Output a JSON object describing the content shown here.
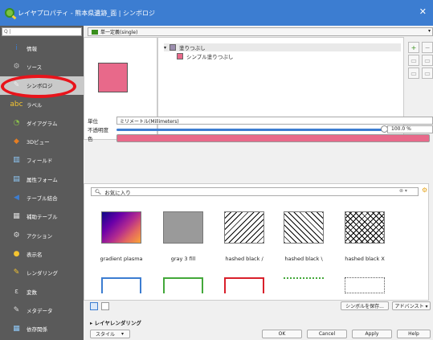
{
  "window": {
    "title": "レイヤプロパティ - 熊本県遺跡_面 | シンボロジ",
    "close_glyph": "✕"
  },
  "sidebar": {
    "search_text": "Q |",
    "items": [
      {
        "label": "情報",
        "icon": "info-icon",
        "glyph": "i",
        "color": "#3c7dd1"
      },
      {
        "label": "ソース",
        "icon": "source-icon",
        "glyph": "⚙",
        "color": "#bbbbbb"
      },
      {
        "label": "シンボロジ",
        "icon": "paintbrush-icon",
        "glyph": "✎",
        "color": "#eeeeee"
      },
      {
        "label": "ラベル",
        "icon": "labels-icon",
        "glyph": "abc",
        "color": "#f4c430"
      },
      {
        "label": "ダイアグラム",
        "icon": "diagram-icon",
        "glyph": "◔",
        "color": "#8bc34a"
      },
      {
        "label": "3Dビュー",
        "icon": "3d-view-icon",
        "glyph": "◆",
        "color": "#e67e22"
      },
      {
        "label": "フィールド",
        "icon": "fields-icon",
        "glyph": "▥",
        "color": "#90caf9"
      },
      {
        "label": "属性フォーム",
        "icon": "attributes-form-icon",
        "glyph": "▤",
        "color": "#90caf9"
      },
      {
        "label": "テーブル結合",
        "icon": "joins-icon",
        "glyph": "◀",
        "color": "#3c7dd1"
      },
      {
        "label": "補助テーブル",
        "icon": "auxiliary-storage-icon",
        "glyph": "▦",
        "color": "#dddddd"
      },
      {
        "label": "アクション",
        "icon": "actions-icon",
        "glyph": "⚙",
        "color": "#dddddd"
      },
      {
        "label": "表示名",
        "icon": "display-icon",
        "glyph": "●",
        "color": "#f4c430"
      },
      {
        "label": "レンダリング",
        "icon": "rendering-icon",
        "glyph": "✎",
        "color": "#f4c430"
      },
      {
        "label": "変数",
        "icon": "variables-icon",
        "glyph": "ε",
        "color": "#dddddd"
      },
      {
        "label": "メタデータ",
        "icon": "metadata-icon",
        "glyph": "✎",
        "color": "#dddddd"
      },
      {
        "label": "依存関係",
        "icon": "dependencies-icon",
        "glyph": "▦",
        "color": "#90caf9"
      }
    ],
    "selected_index": 2
  },
  "renderer": {
    "selected": "単一定義(single)"
  },
  "symbol_tree": {
    "fill_label": "塗りつぶし",
    "layer_label": "シンプル塗りつぶし",
    "fill_color": "#e8698a",
    "layer_color": "#9b8dae"
  },
  "properties": {
    "unit_label": "単位",
    "unit_value": "ミリメートル(Millimeters)",
    "opacity_label": "不透明度",
    "opacity_value": "100.0 %",
    "opacity_fraction": 1.0,
    "color_label": "色",
    "color_value": "#e8698a"
  },
  "library": {
    "search_placeholder": "お気に入り",
    "symbols": [
      {
        "name": "gradient  plasma"
      },
      {
        "name": "gray 3 fill"
      },
      {
        "name": "hashed black /"
      },
      {
        "name": "hashed black \\"
      },
      {
        "name": "hashed black X"
      }
    ]
  },
  "buttons": {
    "save_symbol": "シンボルを保存...",
    "advanced": "アドバンスト ▾",
    "ok": "OK",
    "cancel": "Cancel",
    "apply": "Apply",
    "help": "Help"
  },
  "layer_rendering": {
    "label": "レイヤレンダリング"
  },
  "style": {
    "label": "スタイル"
  }
}
